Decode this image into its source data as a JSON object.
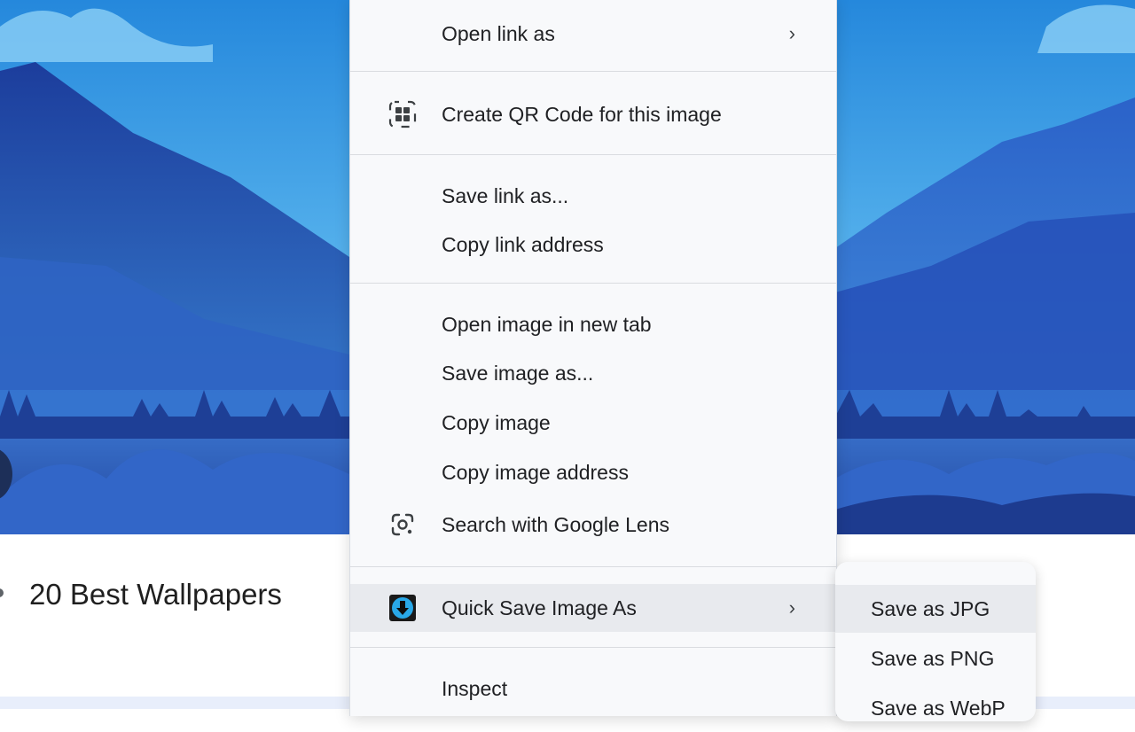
{
  "page": {
    "title": "20 Best Wallpapers",
    "colors": {
      "sky_top": "#2c8fe0",
      "sky_bottom": "#9fd8f6",
      "mountain_dark": "#1f3f9b",
      "mountain_mid": "#2f5fc4",
      "lake": "#2a4fb5"
    }
  },
  "context_menu": {
    "items": [
      {
        "label": "Open link as",
        "icon": "",
        "has_submenu": true
      },
      {
        "label": "Create QR Code for this image",
        "icon": "qr-code-icon",
        "has_submenu": false
      },
      {
        "label": "Save link as...",
        "icon": "",
        "has_submenu": false
      },
      {
        "label": "Copy link address",
        "icon": "",
        "has_submenu": false
      },
      {
        "label": "Open image in new tab",
        "icon": "",
        "has_submenu": false
      },
      {
        "label": "Save image as...",
        "icon": "",
        "has_submenu": false
      },
      {
        "label": "Copy image",
        "icon": "",
        "has_submenu": false
      },
      {
        "label": "Copy image address",
        "icon": "",
        "has_submenu": false
      },
      {
        "label": "Search with Google Lens",
        "icon": "google-lens-icon",
        "has_submenu": false
      },
      {
        "label": "Quick Save Image As",
        "icon": "quick-save-extension-icon",
        "has_submenu": true,
        "highlighted": true
      },
      {
        "label": "Inspect",
        "icon": "",
        "has_submenu": false
      }
    ],
    "arrow_glyph": "›"
  },
  "submenu": {
    "items": [
      {
        "label": "Save as JPG",
        "highlighted": true
      },
      {
        "label": "Save as PNG"
      },
      {
        "label": "Save as WebP"
      }
    ]
  }
}
